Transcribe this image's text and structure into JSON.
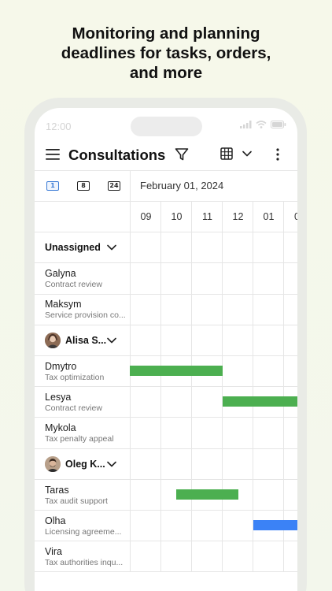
{
  "headline": {
    "line1": "Monitoring and planning",
    "line2": "deadlines for tasks, orders,",
    "line3": "and more"
  },
  "status_bar": {
    "time": "12:00"
  },
  "toolbar": {
    "title": "Consultations",
    "icons": [
      "menu-icon",
      "filter-icon",
      "calendar-grid-icon",
      "chevron-down-icon",
      "more-vert-icon"
    ]
  },
  "zoom_options": [
    "1",
    "8",
    "24"
  ],
  "zoom_selected": "1",
  "date": "February 01, 2024",
  "hours": [
    "09",
    "10",
    "11",
    "12",
    "01",
    "0"
  ],
  "colors": {
    "green": "#4caf50",
    "blue": "#3b82f6",
    "accent": "#3a7bd5"
  },
  "groups": [
    {
      "name": "Unassigned",
      "rows": [
        {
          "name": "Galyna",
          "sub": "Contract review"
        },
        {
          "name": "Maksym",
          "sub": "Service provision co..."
        }
      ]
    },
    {
      "name": "Alisa S...",
      "rows": [
        {
          "name": "Dmytro",
          "sub": "Tax optimization"
        },
        {
          "name": "Lesya",
          "sub": "Contract review"
        },
        {
          "name": "Mykola",
          "sub": "Tax penalty appeal"
        }
      ]
    },
    {
      "name": "Oleg K...",
      "rows": [
        {
          "name": "Taras",
          "sub": "Tax audit support"
        },
        {
          "name": "Olha",
          "sub": "Licensing agreeme..."
        },
        {
          "name": "Vira",
          "sub": "Tax authorities inqu..."
        }
      ]
    }
  ]
}
